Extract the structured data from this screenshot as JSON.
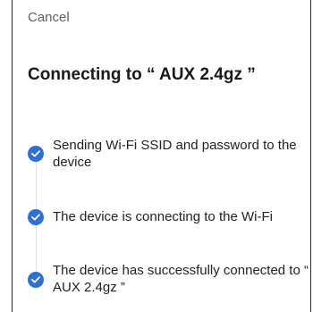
{
  "header": {
    "cancel_label": "Cancel",
    "title": "Connecting to “ AUX 2.4gz ”"
  },
  "steps": [
    {
      "text": "Sending Wi-Fi SSID and password to the device",
      "status": "done",
      "icon": "check-circle-icon"
    },
    {
      "text": "The device is connecting to the Wi-Fi",
      "status": "done",
      "icon": "check-circle-icon"
    },
    {
      "text": "The device has successfully connected to “ AUX 2.4gz ”",
      "status": "done",
      "icon": "check-circle-icon"
    }
  ],
  "colors": {
    "accent": "#2f6fd8",
    "text_primary": "#1a1a1a",
    "text_secondary": "#5f5f5f",
    "timeline": "#d8e0ea"
  }
}
